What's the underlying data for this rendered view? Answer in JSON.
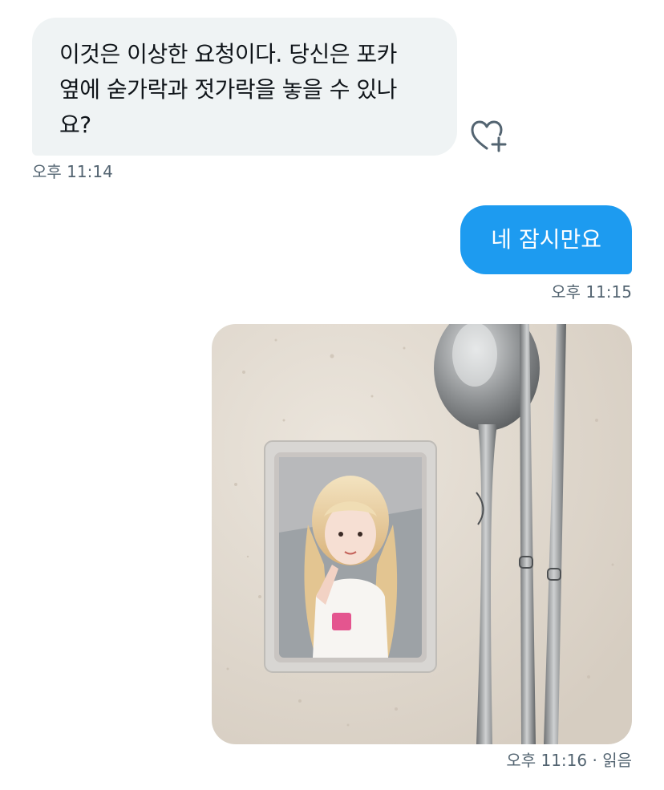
{
  "messages": [
    {
      "direction": "received",
      "text": "이것은 이상한 요청이다. 당신은 포카 옆에 숟가락과 젓가락을 놓을 수 있나요?",
      "lines": [
        "이것은 이상한 요청이다. 당신은 포카",
        "옆에 숟가락과 젓가락을 놓을 수 있나",
        "요?"
      ],
      "time": "오후 11:14",
      "reaction_icon": "heart-plus-icon"
    },
    {
      "direction": "sent",
      "text": "네 잠시만요",
      "time": "오후 11:15"
    },
    {
      "direction": "sent",
      "type": "image",
      "image_content": "photocard-with-spoon-and-chopsticks",
      "time_status": "오후 11:16 · 읽음"
    }
  ],
  "colors": {
    "received_bubble": "#eff3f4",
    "sent_bubble": "#1d9bf0",
    "timestamp": "#536471",
    "text": "#0f1419"
  }
}
